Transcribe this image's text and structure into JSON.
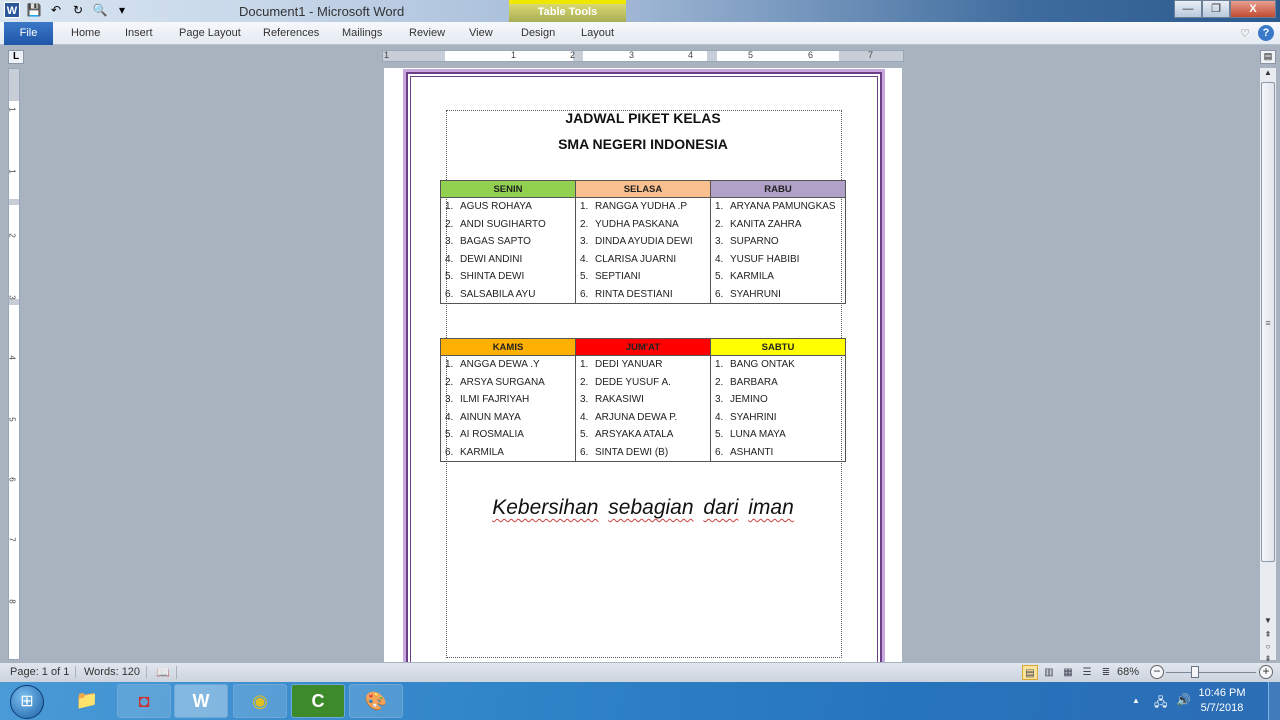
{
  "window": {
    "title": "Document1  -  Microsoft Word",
    "context_tab_group": "Table Tools",
    "controls": {
      "minimize": "—",
      "restore": "❐",
      "close": "X"
    }
  },
  "quick_access": {
    "app_icon": "W",
    "save_icon": "💾",
    "undo_icon": "↶",
    "redo_icon": "↻",
    "print_preview_icon": "🔍",
    "customize_icon": "▾"
  },
  "ribbon": {
    "file": "File",
    "tabs": [
      "Home",
      "Insert",
      "Page Layout",
      "References",
      "Mailings",
      "Review",
      "View",
      "Design",
      "Layout"
    ],
    "minimize_ribbon_icon": "♡",
    "help_icon": "?"
  },
  "ruler": {
    "corner": "L",
    "h_numbers": [
      "1",
      "1",
      "2",
      "3",
      "4",
      "5",
      "6",
      "7"
    ],
    "v_numbers": [
      "1",
      "1",
      "2",
      "3",
      "4",
      "5",
      "6",
      "7",
      "8"
    ]
  },
  "document": {
    "title": "JADWAL PIKET KELAS",
    "subtitle": "SMA NEGERI INDONESIA",
    "tables": [
      {
        "days": [
          {
            "name": "SENIN",
            "color": "#92d050",
            "members": [
              "AGUS ROHAYA",
              "ANDI SUGIHARTO",
              "BAGAS SAPTO",
              "DEWI ANDINI",
              "SHINTA DEWI",
              "SALSABILA AYU"
            ]
          },
          {
            "name": "SELASA",
            "color": "#fabf8f",
            "members": [
              "RANGGA YUDHA .P",
              "YUDHA PASKANA",
              "DINDA AYUDIA DEWI",
              "CLARISA JUARNI",
              "SEPTIANI",
              "RINTA DESTIANI"
            ]
          },
          {
            "name": "RABU",
            "color": "#b1a0c7",
            "members": [
              "ARYANA PAMUNGKAS",
              "KANITA ZAHRA",
              "SUPARNO",
              "YUSUF HABIBI",
              "KARMILA",
              "SYAHRUNI"
            ]
          }
        ]
      },
      {
        "days": [
          {
            "name": "KAMIS",
            "color": "#ffb000",
            "members": [
              "ANGGA DEWA .Y",
              "ARSYA SURGANA",
              "ILMI FAJRIYAH",
              "AINUN MAYA",
              "AI ROSMALIA",
              "KARMILA"
            ]
          },
          {
            "name": "JUM'AT",
            "color": "#ff0000",
            "members": [
              "DEDI YANUAR",
              "DEDE YUSUF A.",
              "RAKASIWI",
              "ARJUNA DEWA P.",
              "ARSYAKA ATALA",
              "SINTA DEWI (B)"
            ]
          },
          {
            "name": "SABTU",
            "color": "#ffff00",
            "members": [
              "BANG ONTAK",
              "BARBARA",
              "JEMINO",
              "SYAHRINI",
              "LUNA MAYA",
              "ASHANTI"
            ]
          }
        ]
      }
    ],
    "motto_words": [
      "Kebersihan",
      "sebagian",
      "dari",
      "iman"
    ]
  },
  "statusbar": {
    "page": "Page: 1 of 1",
    "words": "Words: 120",
    "proofing_icon": "📖",
    "zoom": "68%",
    "zoom_level_percent": 68
  },
  "taskbar": {
    "start_icon": "⊞",
    "apps": [
      {
        "name": "file-explorer",
        "glyph": "📁"
      },
      {
        "name": "media-app",
        "glyph": "◘"
      },
      {
        "name": "word",
        "glyph": "W"
      },
      {
        "name": "chrome",
        "glyph": "◉"
      },
      {
        "name": "camtasia",
        "glyph": "C"
      },
      {
        "name": "paint",
        "glyph": "🎨"
      }
    ],
    "time": "10:46 PM",
    "date": "5/7/2018",
    "tray_up_icon": "▲",
    "network_icon": "🖧",
    "volume_icon": "🔊"
  }
}
